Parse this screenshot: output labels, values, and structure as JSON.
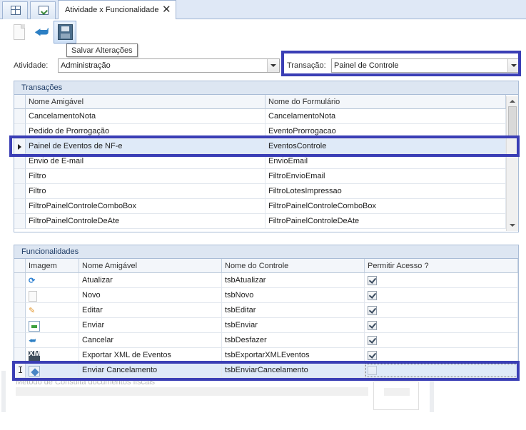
{
  "tabs": {
    "active_label": "Atividade x Funcionalidade",
    "close_glyph": "✕",
    "icons": [
      "grid-icon",
      "clipboard-check-icon"
    ]
  },
  "toolbar": {
    "buttons": [
      "new-document-icon",
      "undo-icon",
      "save-disk-icon"
    ],
    "tooltip": "Salvar Alterações"
  },
  "filters": {
    "atividade_label": "Atividade:",
    "atividade_value": "Administração",
    "transacao_label": "Transação:",
    "transacao_value": "Painel de Controle"
  },
  "transacoes": {
    "title": "Transações",
    "columns": [
      "Nome Amigável",
      "Nome do Formulário"
    ],
    "rows": [
      {
        "nome": "CancelamentoNota",
        "form": "CancelamentoNota"
      },
      {
        "nome": "Pedido de Prorrogação",
        "form": "EventoProrrogacao"
      },
      {
        "nome": "Painel de Eventos de NF-e",
        "form": "EventosControle"
      },
      {
        "nome": "Envio de E-mail",
        "form": "EnvioEmail"
      },
      {
        "nome": "Filtro",
        "form": "FiltroEnvioEmail"
      },
      {
        "nome": "Filtro",
        "form": "FiltroLotesImpressao"
      },
      {
        "nome": "FiltroPainelControleComboBox",
        "form": "FiltroPainelControleComboBox"
      },
      {
        "nome": "FiltroPainelControleDeAte",
        "form": "FiltroPainelControleDeAte"
      }
    ],
    "selected_index": 2
  },
  "funcionalidades": {
    "title": "Funcionalidades",
    "columns": [
      "Imagem",
      "Nome Amigável",
      "Nome do Controle",
      "Permitir Acesso ?"
    ],
    "rows": [
      {
        "icon": "refresh-icon",
        "nome": "Atualizar",
        "controle": "tsbAtualizar",
        "acesso": true
      },
      {
        "icon": "new-page-icon",
        "nome": "Novo",
        "controle": "tsbNovo",
        "acesso": true
      },
      {
        "icon": "edit-pencil-icon",
        "nome": "Editar",
        "controle": "tsbEditar",
        "acesso": true
      },
      {
        "icon": "send-icon",
        "nome": "Enviar",
        "controle": "tsbEnviar",
        "acesso": true
      },
      {
        "icon": "undo-icon",
        "nome": "Cancelar",
        "controle": "tsbDesfazer",
        "acesso": true
      },
      {
        "icon": "xml-export-icon",
        "nome": "Exportar XML de Eventos",
        "controle": "tsbExportarXMLEventos",
        "acesso": true
      },
      {
        "icon": "send-cancel-icon",
        "nome": "Enviar Cancelamento",
        "controle": "tsbEnviarCancelamento",
        "acesso": false
      }
    ],
    "editing_index": 6
  },
  "background": {
    "faded_text": "Método de Consulta documentos fiscais"
  },
  "colors": {
    "highlight_border": "#3a3eb5",
    "group_header": "#dde6f2",
    "selected_row": "#dfeaf8"
  }
}
